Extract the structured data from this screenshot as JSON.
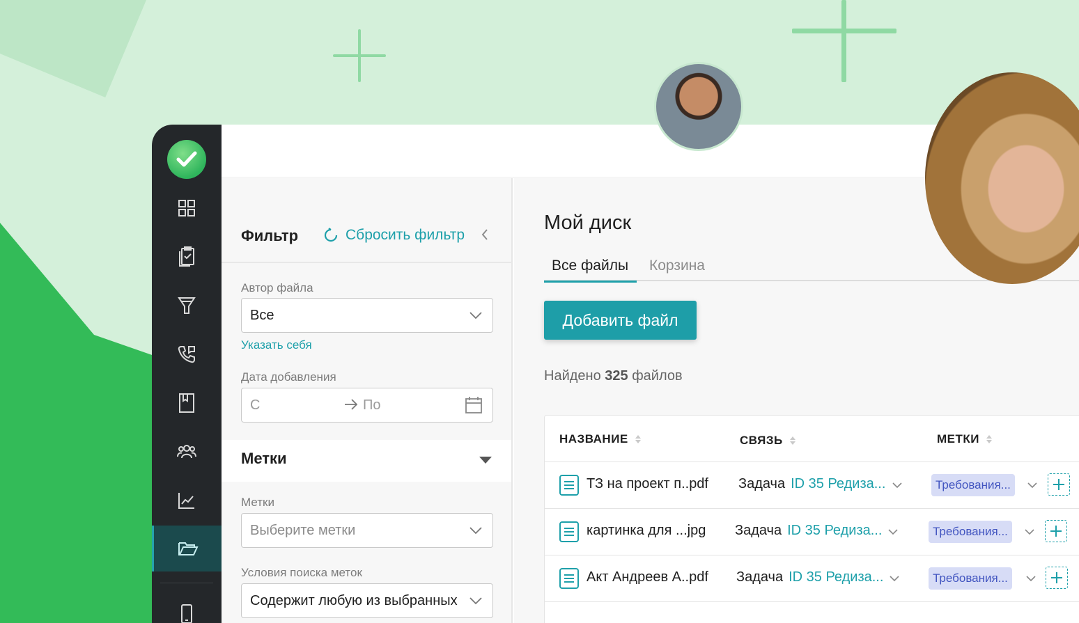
{
  "sidebar": {
    "items": [
      {
        "icon": "dashboard-grid-icon"
      },
      {
        "icon": "clipboard-tasks-icon"
      },
      {
        "icon": "funnel-icon"
      },
      {
        "icon": "phone-calls-icon"
      },
      {
        "icon": "book-icon"
      },
      {
        "icon": "users-icon"
      },
      {
        "icon": "chart-icon"
      },
      {
        "icon": "folder-open-icon",
        "active": true
      },
      {
        "icon": "mobile-icon"
      }
    ]
  },
  "filter": {
    "title": "Фильтр",
    "reset_label": "Сбросить фильтр",
    "author_label": "Автор файла",
    "author_value": "Все",
    "self_link": "Указать себя",
    "date_label": "Дата добавления",
    "date_from_placeholder": "С",
    "date_to_placeholder": "По",
    "tags_section": "Метки",
    "tags_label": "Метки",
    "tags_placeholder": "Выберите метки",
    "search_cond_label": "Условия поиска меток",
    "search_cond_value": "Содержит любую из выбранных"
  },
  "main": {
    "title": "Мой диск",
    "tabs": [
      {
        "label": "Все файлы",
        "active": true
      },
      {
        "label": "Корзина",
        "active": false
      }
    ],
    "add_button": "Добавить файл",
    "found_prefix": "Найдено",
    "found_count": "325",
    "found_suffix": "файлов",
    "table": {
      "columns": [
        "НАЗВАНИЕ",
        "СВЯЗЬ",
        "МЕТКИ"
      ],
      "rows": [
        {
          "name": "ТЗ на проект п..pdf",
          "rel_type": "Задача",
          "rel_id": "ID 35 Редиза...",
          "tag": "Требования..."
        },
        {
          "name": "картинка для ...jpg",
          "rel_type": "Задача",
          "rel_id": "ID 35 Редиза...",
          "tag": "Требования..."
        },
        {
          "name": "Акт Андреев А..pdf",
          "rel_type": "Задача",
          "rel_id": "ID 35 Редиза...",
          "tag": "Требования..."
        }
      ]
    }
  },
  "colors": {
    "accent": "#1ea0aa",
    "sidebar_bg": "#24272a",
    "tag_bg": "#d7dcf6",
    "bg_green": "#33bb58"
  }
}
